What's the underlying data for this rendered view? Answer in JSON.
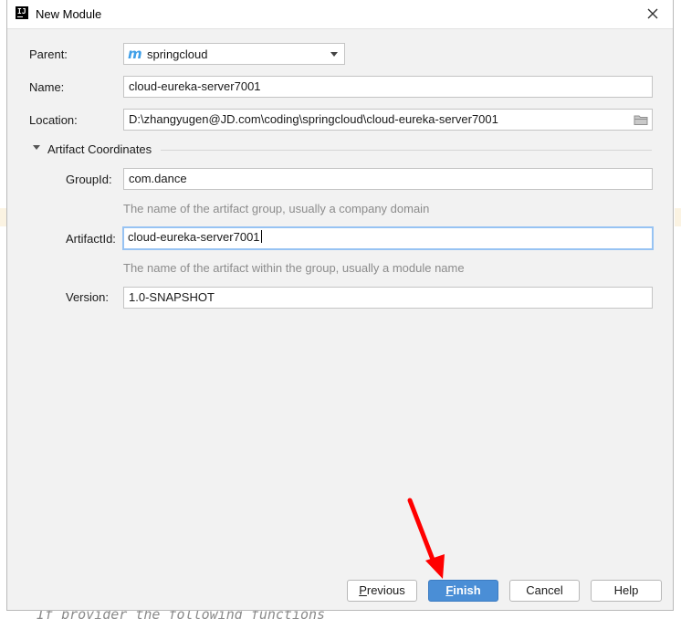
{
  "window": {
    "title": "New Module",
    "app_icon_text": "IJ"
  },
  "form": {
    "parent": {
      "label": "Parent:",
      "value": "springcloud",
      "icon": "maven-icon"
    },
    "name": {
      "label": "Name:",
      "value": "cloud-eureka-server7001"
    },
    "location": {
      "label": "Location:",
      "value": "D:\\zhangyugen@JD.com\\coding\\springcloud\\cloud-eureka-server7001",
      "icon": "folder-icon"
    }
  },
  "artifact": {
    "section_title": "Artifact Coordinates",
    "groupid": {
      "label": "GroupId:",
      "value": "com.dance",
      "hint": "The name of the artifact group, usually a company domain"
    },
    "artifactid": {
      "label": "ArtifactId:",
      "value": "cloud-eureka-server7001",
      "hint": "The name of the artifact within the group, usually a module name"
    },
    "version": {
      "label": "Version:",
      "value": "1.0-SNAPSHOT"
    }
  },
  "buttons": {
    "previous": "Previous",
    "finish": "Finish",
    "cancel": "Cancel",
    "help": "Help"
  },
  "background": {
    "code_line": "If provider the following functions"
  },
  "colors": {
    "accent": "#4a8ed6",
    "focus_border": "#97c3f3",
    "annotation_arrow": "#ff0000",
    "maven_icon": "#3f9fe8"
  }
}
